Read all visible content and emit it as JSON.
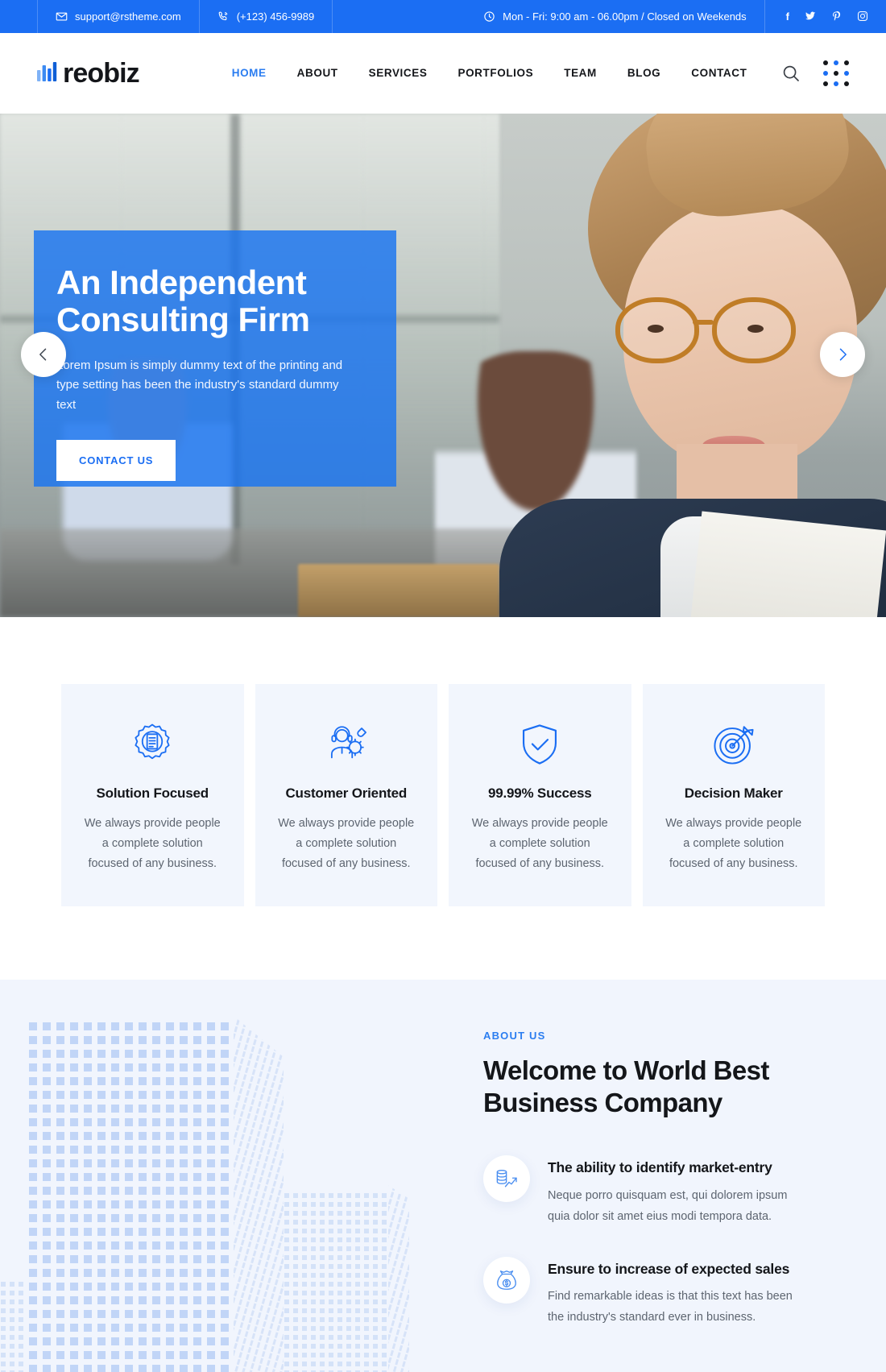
{
  "topbar": {
    "email": "support@rstheme.com",
    "phone": "(+123) 456-9989",
    "hours": "Mon - Fri: 9:00 am - 06.00pm / Closed on Weekends",
    "social": [
      {
        "name": "facebook",
        "glyph": "f"
      },
      {
        "name": "twitter",
        "glyph": "✈"
      },
      {
        "name": "pinterest",
        "glyph": "P"
      },
      {
        "name": "instagram",
        "glyph": "▣"
      }
    ],
    "bg_color": "#1b6ef3"
  },
  "header": {
    "logo_text": "reobiz",
    "nav": [
      {
        "label": "HOME",
        "active": true
      },
      {
        "label": "ABOUT",
        "active": false
      },
      {
        "label": "SERVICES",
        "active": false
      },
      {
        "label": "PORTFOLIOS",
        "active": false
      },
      {
        "label": "TEAM",
        "active": false
      },
      {
        "label": "BLOG",
        "active": false
      },
      {
        "label": "CONTACT",
        "active": false
      }
    ],
    "accent_color": "#2b7df0"
  },
  "hero": {
    "title": "An Independent Consulting Firm",
    "subtitle": "Lorem Ipsum is simply dummy text of the printing and type setting has been the industry's standard dummy text",
    "cta_label": "CONTACT US",
    "overlay_color": "#1874f0"
  },
  "features": [
    {
      "icon": "gear-document-icon",
      "title": "Solution Focused",
      "text": "We always provide people a complete solution focused of any business."
    },
    {
      "icon": "support-agent-icon",
      "title": "Customer Oriented",
      "text": "We always provide people a complete solution focused of any business."
    },
    {
      "icon": "shield-check-icon",
      "title": "99.99% Success",
      "text": "We always provide people a complete solution focused of any business."
    },
    {
      "icon": "target-dart-icon",
      "title": "Decision Maker",
      "text": "We always provide people a complete solution focused of any business."
    }
  ],
  "about": {
    "eyebrow": "ABOUT US",
    "title": "Welcome to World Best Business Company",
    "items": [
      {
        "icon": "growth-chart-coins-icon",
        "title": "The ability to identify market-entry",
        "text": "Neque porro quisquam est, qui dolorem ipsum quia dolor sit amet eius modi tempora data."
      },
      {
        "icon": "money-bag-icon",
        "title": "Ensure to increase of expected sales",
        "text": "Find remarkable ideas is that this text has been the industry's standard ever in business."
      }
    ],
    "bg_color": "#f1f5fd"
  }
}
